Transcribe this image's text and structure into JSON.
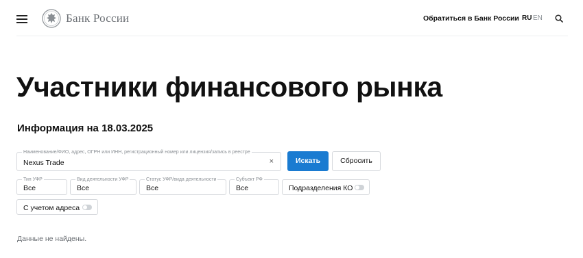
{
  "header": {
    "logo_text": "Банк России",
    "contact_link": "Обратиться в Банк России",
    "lang_ru": "RU",
    "lang_en": "EN"
  },
  "page": {
    "title": "Участники финансового рынка",
    "subtitle": "Информация на 18.03.2025"
  },
  "search": {
    "label": "Наименование/ФИО, адрес, ОГРН или ИНН, регистрационный номер или лицензия/запись в реестре",
    "value": "Nexus Trade",
    "clear": "×",
    "search_button": "Искать",
    "reset_button": "Сбросить"
  },
  "filters": {
    "type": {
      "label": "Тип УФР",
      "value": "Все"
    },
    "activity": {
      "label": "Вид деятельности УФР",
      "value": "Все"
    },
    "status": {
      "label": "Статус УФР/вида деятельности",
      "value": "Все"
    },
    "subject": {
      "label": "Субъект РФ",
      "value": "Все"
    },
    "ko_toggle": {
      "label": "Подразделения КО",
      "on": false
    },
    "address_toggle": {
      "label": "С учетом адреса",
      "on": false
    }
  },
  "result": {
    "message": "Данные не найдены."
  },
  "colors": {
    "accent": "#1a7bd1",
    "text": "#111111",
    "muted": "#6b6f74",
    "border": "#d5d8dc"
  }
}
